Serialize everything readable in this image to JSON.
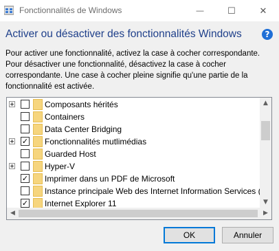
{
  "window": {
    "title": "Fonctionnalités de Windows",
    "controls": {
      "minimize": "—",
      "maximize": "☐",
      "close": "✕"
    }
  },
  "header": {
    "heading": "Activer ou désactiver des fonctionnalités Windows",
    "help_icon": "?",
    "description": "Pour activer une fonctionnalité, activez la case à cocher correspondante.\nPour désactiver une fonctionnalité, désactivez la case à cocher\ncorrespondante. Une case à cocher pleine signifie qu'une partie de la\nfonctionnalité est activée."
  },
  "features": [
    {
      "label": "Composants hérités",
      "expandable": true,
      "state": "unchecked"
    },
    {
      "label": "Containers",
      "expandable": false,
      "state": "unchecked"
    },
    {
      "label": "Data Center Bridging",
      "expandable": false,
      "state": "unchecked"
    },
    {
      "label": "Fonctionnalités mutlimédias",
      "expandable": true,
      "state": "checked"
    },
    {
      "label": "Guarded Host",
      "expandable": false,
      "state": "unchecked"
    },
    {
      "label": "Hyper-V",
      "expandable": true,
      "state": "unchecked"
    },
    {
      "label": "Imprimer dans un PDF de Microsoft",
      "expandable": false,
      "state": "checked"
    },
    {
      "label": "Instance principale Web des Internet Information Services (IIS",
      "expandable": false,
      "state": "unchecked"
    },
    {
      "label": "Internet Explorer 11",
      "expandable": false,
      "state": "checked"
    }
  ],
  "buttons": {
    "ok": "OK",
    "cancel": "Annuler"
  },
  "colors": {
    "heading": "#1e3f8a",
    "accent": "#0078d7",
    "folder": "#f6d57e"
  }
}
